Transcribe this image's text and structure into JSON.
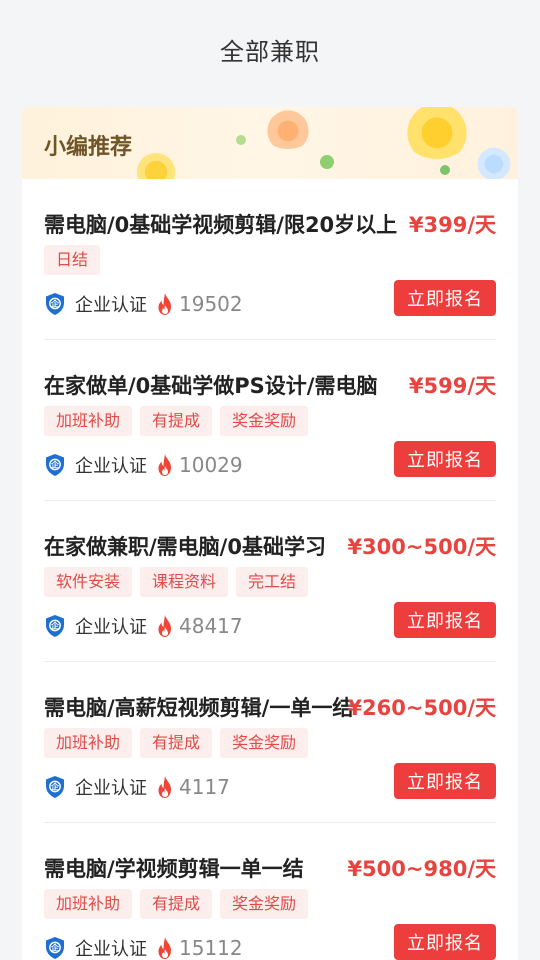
{
  "header": {
    "title": "全部兼职"
  },
  "banner": {
    "title": "小编推荐"
  },
  "colors": {
    "accent": "#ee3d3d",
    "tag_bg": "#fdeeee",
    "tag_text": "#e04b47",
    "salary": "#e8433f",
    "cert_blue": "#1f6fd1"
  },
  "jobs": [
    {
      "title": "需电脑/0基础学视频剪辑/限20岁以上",
      "salary": "¥399/天",
      "tags": [
        "日结"
      ],
      "cert": "企业认证",
      "hot": "19502",
      "apply": "立即报名"
    },
    {
      "title": "在家做单/0基础学做PS设计/需电脑",
      "salary": "¥599/天",
      "tags": [
        "加班补助",
        "有提成",
        "奖金奖励"
      ],
      "cert": "企业认证",
      "hot": "10029",
      "apply": "立即报名"
    },
    {
      "title": "在家做兼职/需电脑/0基础学习",
      "salary": "¥300~500/天",
      "tags": [
        "软件安装",
        "课程资料",
        "完工结"
      ],
      "cert": "企业认证",
      "hot": "48417",
      "apply": "立即报名"
    },
    {
      "title": "需电脑/高薪短视频剪辑/一单一结",
      "salary": "¥260~500/天",
      "tags": [
        "加班补助",
        "有提成",
        "奖金奖励"
      ],
      "cert": "企业认证",
      "hot": "4117",
      "apply": "立即报名"
    },
    {
      "title": "需电脑/学视频剪辑一单一结",
      "salary": "¥500~980/天",
      "tags": [
        "加班补助",
        "有提成",
        "奖金奖励"
      ],
      "cert": "企业认证",
      "hot": "15112",
      "apply": "立即报名"
    }
  ]
}
